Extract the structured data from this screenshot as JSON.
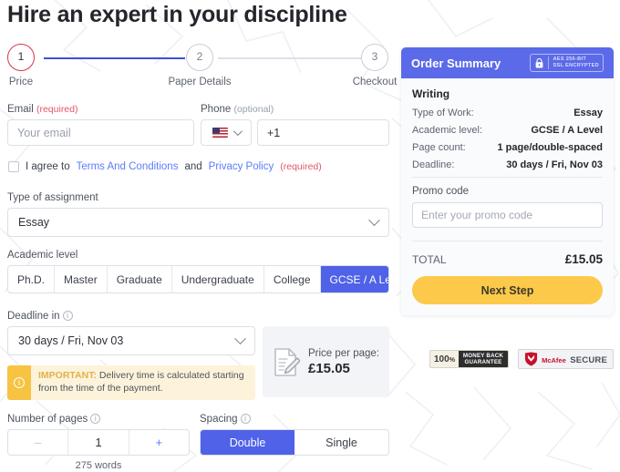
{
  "page": {
    "title": "Hire an expert in your discipline"
  },
  "stepper": {
    "steps": [
      {
        "number": "1",
        "label": "Price",
        "state": "active"
      },
      {
        "number": "2",
        "label": "Paper Details",
        "state": "inactive"
      },
      {
        "number": "3",
        "label": "Checkout",
        "state": "inactive"
      }
    ],
    "active_color": "#d6374b",
    "track_done_color": "#3f51d8",
    "track_todo_color": "#dde0e8"
  },
  "form": {
    "email": {
      "label": "Email",
      "required_tag": "(required)",
      "placeholder": "Your email",
      "value": ""
    },
    "phone": {
      "label": "Phone",
      "optional_tag": "(optional)",
      "country_flag": "us-flag-icon",
      "value": "+1"
    },
    "agreement": {
      "checked": false,
      "text_before": "I agree to",
      "terms_link": "Terms And Conditions",
      "text_middle": "and",
      "privacy_link": "Privacy Policy",
      "required_tag": "(required)"
    },
    "assignment": {
      "label": "Type of assignment",
      "value": "Essay"
    },
    "academic_level": {
      "label": "Academic level",
      "options": [
        "Ph.D.",
        "Master",
        "Graduate",
        "Undergraduate",
        "College",
        "GCSE / A Level"
      ],
      "selected": "GCSE / A Level",
      "selected_color": "#4f62e8"
    },
    "deadline": {
      "label": "Deadline in",
      "value": "30 days / Fri, Nov 03",
      "notice_tag": "IMPORTANT:",
      "notice_text": "Delivery time is calculated starting from the time of the payment.",
      "notice_bar_color": "#f6c342",
      "notice_bg_color": "#fdf3da"
    },
    "price_per_page": {
      "label": "Price per page:",
      "value": "£15.05",
      "icon": "document-pencil-icon"
    },
    "pages": {
      "label": "Number of pages",
      "minus": "–",
      "count": "1",
      "plus": "+",
      "words": "275 words"
    },
    "spacing": {
      "label": "Spacing",
      "options": [
        "Double",
        "Single"
      ],
      "selected": "Double",
      "selected_color": "#4f62e8"
    }
  },
  "summary": {
    "header_title": "Order Summary",
    "header_color": "#5b6ae8",
    "ssl_badge": {
      "icon": "lock-icon",
      "line1": "AES 256-BIT",
      "line2": "SSL ENCRYPTED"
    },
    "section_title": "Writing",
    "rows": [
      {
        "key": "Type of Work:",
        "value": "Essay"
      },
      {
        "key": "Academic level:",
        "value": "GCSE / A Level"
      },
      {
        "key": "Page count:",
        "value": "1 page/double-spaced"
      },
      {
        "key": "Deadline:",
        "value": "30 days / Fri, Nov 03"
      }
    ],
    "promo": {
      "label": "Promo code",
      "placeholder": "Enter your promo code",
      "value": ""
    },
    "total_label": "TOTAL",
    "total_value": "£15.05",
    "next_button": "Next Step",
    "next_button_color": "#fcc94a"
  },
  "badges": {
    "money_back": {
      "percent": "100",
      "percent_suffix": "%",
      "line1": "MONEY BACK",
      "line2": "GUARANTEE"
    },
    "mcafee": {
      "icon": "shield-icon",
      "line1": "McAfee",
      "line2": "SECURE",
      "trademark": "™"
    }
  }
}
